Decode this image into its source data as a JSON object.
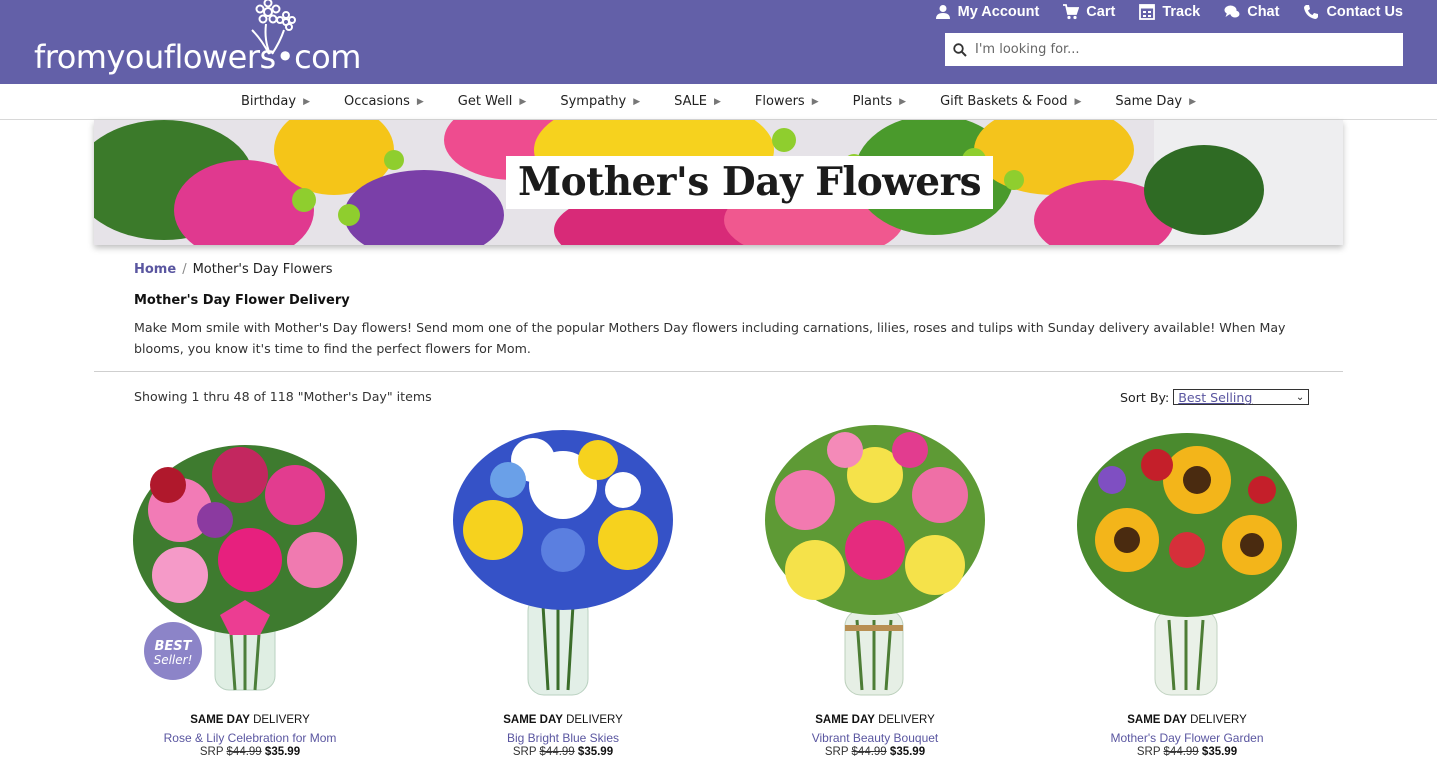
{
  "logo": {
    "text": "fromyouflowers•com"
  },
  "utility": [
    {
      "label": "My Account",
      "icon": "user-icon"
    },
    {
      "label": "Cart",
      "icon": "cart-icon"
    },
    {
      "label": "Track",
      "icon": "track-icon"
    },
    {
      "label": "Chat",
      "icon": "chat-icon"
    },
    {
      "label": "Contact Us",
      "icon": "phone-icon"
    }
  ],
  "search": {
    "placeholder": "I'm looking for..."
  },
  "nav": [
    "Birthday",
    "Occasions",
    "Get Well",
    "Sympathy",
    "SALE",
    "Flowers",
    "Plants",
    "Gift Baskets & Food",
    "Same Day"
  ],
  "banner": {
    "title": "Mother's Day Flowers"
  },
  "breadcrumb": {
    "home": "Home",
    "sep": "/",
    "current": "Mother's Day Flowers"
  },
  "intro": {
    "heading": "Mother's Day Flower Delivery",
    "text": "Make Mom smile with Mother's Day flowers! Send mom one of the popular Mothers Day flowers including carnations, lilies, roses and tulips with Sunday delivery available! When May blooms, you know it's time to find the perfect flowers for Mom."
  },
  "listing": {
    "showing": "Showing 1 thru 48 of 118 \"Mother's Day\" items",
    "sort_label": "Sort By:",
    "sort_value": "Best Selling"
  },
  "badge": {
    "line1": "BEST",
    "line2": "Seller!"
  },
  "products": [
    {
      "delivery_bold": "SAME DAY",
      "delivery_rest": " DELIVERY",
      "name": "Rose & Lily Celebration for Mom",
      "srp_label": "SRP ",
      "srp": "$44.99",
      "price": "$35.99"
    },
    {
      "delivery_bold": "SAME DAY",
      "delivery_rest": " DELIVERY",
      "name": "Big Bright Blue Skies",
      "srp_label": "SRP ",
      "srp": "$44.99",
      "price": "$35.99"
    },
    {
      "delivery_bold": "SAME DAY",
      "delivery_rest": " DELIVERY",
      "name": "Vibrant Beauty Bouquet",
      "srp_label": "SRP ",
      "srp": "$44.99",
      "price": "$35.99"
    },
    {
      "delivery_bold": "SAME DAY",
      "delivery_rest": " DELIVERY",
      "name": "Mother's Day Flower Garden",
      "srp_label": "SRP ",
      "srp": "$44.99",
      "price": "$35.99"
    }
  ],
  "colors": {
    "brand": "#6360a8",
    "link": "#5a56a0"
  }
}
